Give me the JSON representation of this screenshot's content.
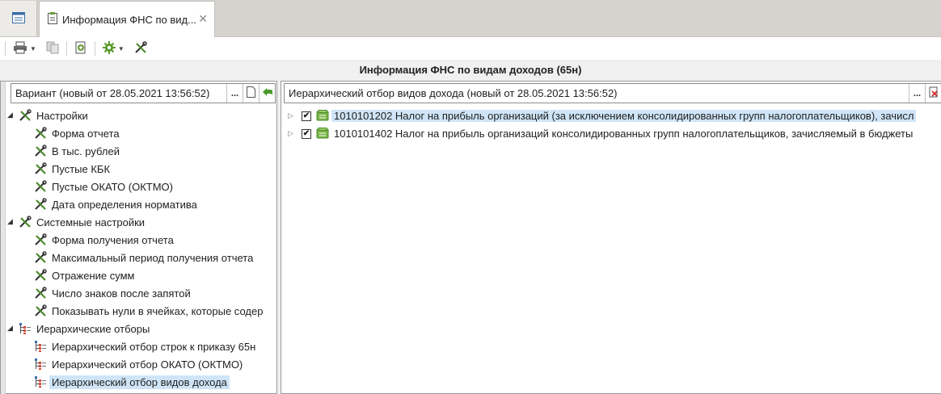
{
  "tabs": {
    "home_icon": "window-icon",
    "active_tab": {
      "label": "Информация ФНС по вид...",
      "close": "✕"
    }
  },
  "toolbar": {
    "buttons": [
      "print-icon",
      "copy-icon",
      "export-icon",
      "settings-icon",
      "tools-icon"
    ]
  },
  "title": "Информация ФНС по видам доходов (65н)",
  "left": {
    "variant_value": "Вариант (новый от 28.05.2021 13:56:52)",
    "ellipsis": "...",
    "tree": [
      {
        "label": "Настройки",
        "level": 0,
        "expanded": true
      },
      {
        "label": "Форма отчета",
        "level": 1
      },
      {
        "label": "В тыс. рублей",
        "level": 1
      },
      {
        "label": "Пустые КБК",
        "level": 1
      },
      {
        "label": "Пустые ОКАТО (ОКТМО)",
        "level": 1
      },
      {
        "label": "Дата определения норматива",
        "level": 1
      },
      {
        "label": "Системные настройки",
        "level": 0,
        "expanded": true
      },
      {
        "label": "Форма получения отчета",
        "level": 1
      },
      {
        "label": "Максимальный период получения отчета",
        "level": 1
      },
      {
        "label": "Отражение сумм",
        "level": 1
      },
      {
        "label": "Число знаков после запятой",
        "level": 1
      },
      {
        "label": "Показывать нули в ячейках, которые содер",
        "level": 1
      },
      {
        "label": "Иерархические отборы",
        "level": 0,
        "expanded": true
      },
      {
        "label": "Иерархический отбор строк к приказу 65н",
        "level": 1
      },
      {
        "label": "Иерархический отбор ОКАТО (ОКТМО)",
        "level": 1
      },
      {
        "label": "Иерархический отбор видов дохода",
        "level": 1,
        "selected": true
      }
    ]
  },
  "right": {
    "filter_value": "Иерархический отбор видов дохода (новый от 28.05.2021 13:56:52)",
    "ellipsis": "...",
    "rows": [
      {
        "label": "1010101202 Налог на прибыль организаций (за исключением консолидированных групп налогоплательщиков), зачисл",
        "checked": true,
        "selected": true
      },
      {
        "label": "1010101402 Налог на прибыль организаций консолидированных групп налогоплательщиков, зачисляемый в бюджеты",
        "checked": true,
        "selected": false
      }
    ]
  },
  "colors": {
    "selection": "#cfe5f7",
    "tree_icon_green": "#4a8a2a",
    "hier_icon_blue": "#3a6fb0"
  }
}
